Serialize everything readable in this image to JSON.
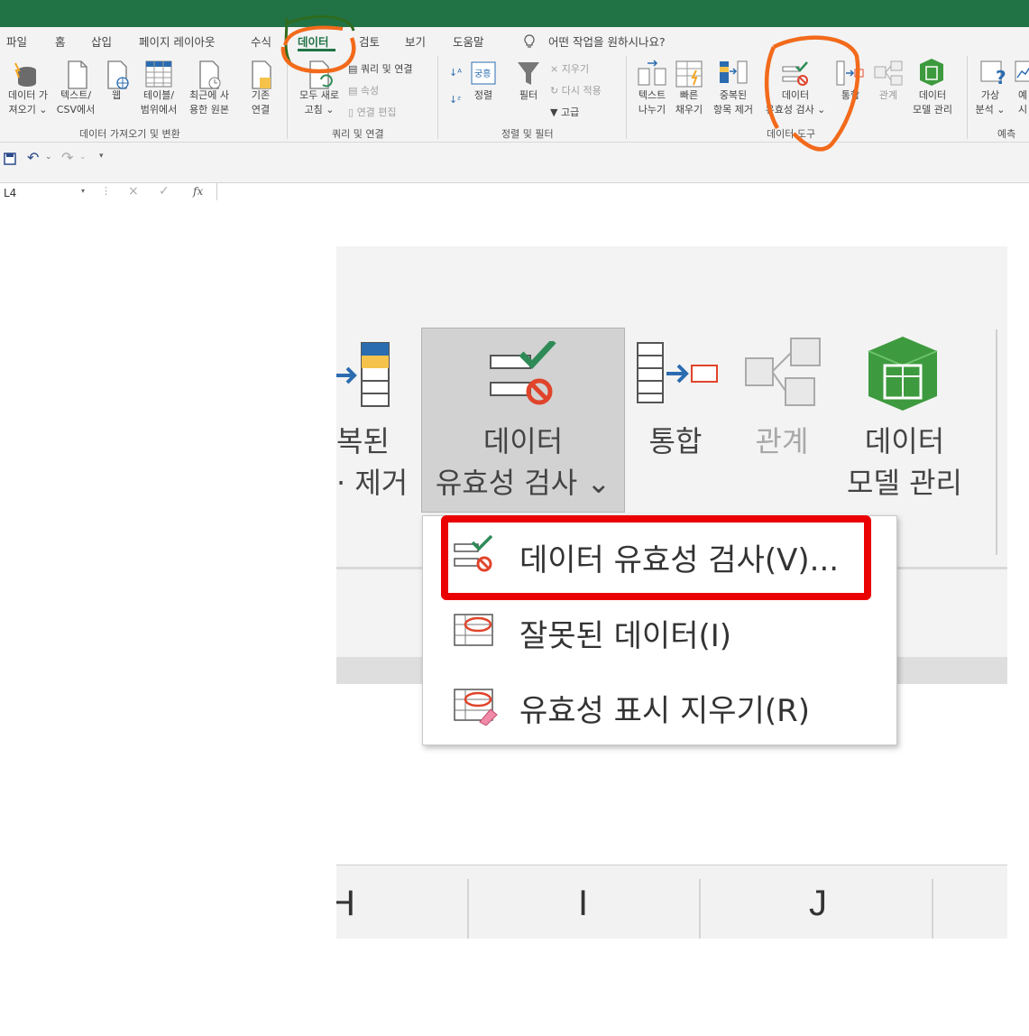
{
  "tabs": [
    "파일",
    "홈",
    "삽입",
    "페이지 레이아웃",
    "수식",
    "데이터",
    "검토",
    "보기",
    "도움말"
  ],
  "active_tab": "데이터",
  "tell_me": "어떤 작업을 원하시나요?",
  "ribbon": {
    "get_data": [
      "데이터 가",
      "져오기 ⌄"
    ],
    "text_csv": [
      "텍스트/",
      "CSV에서"
    ],
    "web": "웹",
    "table_range": [
      "테이블/",
      "범위에서"
    ],
    "recent_sources": [
      "최근에 사",
      "용한 원본"
    ],
    "existing_conn": [
      "기존",
      "연결"
    ],
    "group_get_transform": "데이터 가져오기 및 변환",
    "refresh_all": [
      "모두 새로",
      "고침 ⌄"
    ],
    "queries_connections": "쿼리 및 연결",
    "properties": "속성",
    "edit_links": "연결 편집",
    "group_queries": "쿼리 및 연결",
    "sort": "정렬",
    "filter": "필터",
    "clear": "지우기",
    "reapply": "다시 적용",
    "advanced": "고급",
    "group_sort_filter": "정렬 및 필터",
    "text_to_columns": [
      "텍스트",
      "나누기"
    ],
    "flash_fill": [
      "빠른",
      "채우기"
    ],
    "remove_duplicates": [
      "중복된",
      "항목 제거"
    ],
    "data_validation": [
      "데이터",
      "유효성 검사 ⌄"
    ],
    "consolidate": "통합",
    "relationships": "관계",
    "data_model": [
      "데이터",
      "모델 관리"
    ],
    "group_data_tools": "데이터 도구",
    "what_if": [
      "가상",
      "분석 ⌄"
    ],
    "forecast_sheet": [
      "예",
      "시"
    ],
    "group_forecast": "예측"
  },
  "name_box": "L4",
  "formula_fx": "fx",
  "zoom": {
    "partial_dup": [
      "복된",
      "· 제거"
    ],
    "data_validation": [
      "데이터",
      "유효성 검사 ⌄"
    ],
    "consolidate": "통합",
    "relationships": "관계",
    "data_model": [
      "데이터",
      "모델 관리"
    ],
    "menu": [
      "데이터 유효성 검사(V)...",
      "잘못된 데이터(I)",
      "유효성 표시 지우기(R)"
    ],
    "columns": [
      "H",
      "I",
      "J"
    ]
  },
  "colors": {
    "excel_green": "#217346",
    "annotation_orange": "#f26a1b",
    "annotation_green": "#2e6b1e",
    "highlight_red": "#ea0000"
  }
}
